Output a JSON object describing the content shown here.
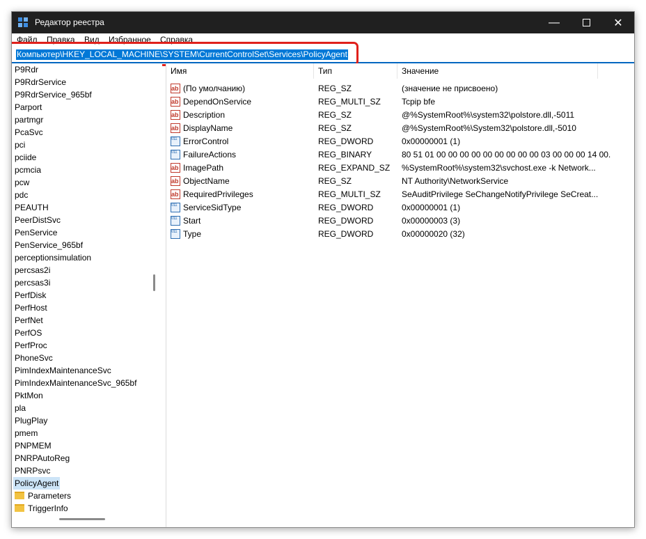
{
  "window": {
    "title": "Редактор реестра",
    "controls": {
      "minimize": "—",
      "maximize": "",
      "close": "✕"
    }
  },
  "menu": [
    "Файл",
    "Правка",
    "Вид",
    "Избранное",
    "Справка"
  ],
  "address": "Компьютер\\HKEY_LOCAL_MACHINE\\SYSTEM\\CurrentControlSet\\Services\\PolicyAgent",
  "tree": [
    "P9Rdr",
    "P9RdrService",
    "P9RdrService_965bf",
    "Parport",
    "partmgr",
    "PcaSvc",
    "pci",
    "pciide",
    "pcmcia",
    "pcw",
    "pdc",
    "PEAUTH",
    "PeerDistSvc",
    "PenService",
    "PenService_965bf",
    "perceptionsimulation",
    "percsas2i",
    "percsas3i",
    "PerfDisk",
    "PerfHost",
    "PerfNet",
    "PerfOS",
    "PerfProc",
    "PhoneSvc",
    "PimIndexMaintenanceSvc",
    "PimIndexMaintenanceSvc_965bf",
    "PktMon",
    "pla",
    "PlugPlay",
    "pmem",
    "PNPMEM",
    "PNRPAutoReg",
    "PNRPsvc",
    "PolicyAgent"
  ],
  "tree_selected": "PolicyAgent",
  "tree_children": [
    "Parameters",
    "TriggerInfo"
  ],
  "columns": {
    "name": "Имя",
    "type": "Тип",
    "value": "Значение"
  },
  "values": [
    {
      "name": "(По умолчанию)",
      "type": "REG_SZ",
      "data": "(значение не присвоено)",
      "icon": "string-value-icon"
    },
    {
      "name": "DependOnService",
      "type": "REG_MULTI_SZ",
      "data": "Tcpip bfe",
      "icon": "string-value-icon"
    },
    {
      "name": "Description",
      "type": "REG_SZ",
      "data": "@%SystemRoot%\\system32\\polstore.dll,-5011",
      "icon": "string-value-icon"
    },
    {
      "name": "DisplayName",
      "type": "REG_SZ",
      "data": "@%SystemRoot%\\System32\\polstore.dll,-5010",
      "icon": "string-value-icon"
    },
    {
      "name": "ErrorControl",
      "type": "REG_DWORD",
      "data": "0x00000001 (1)",
      "icon": "binary-value-icon"
    },
    {
      "name": "FailureActions",
      "type": "REG_BINARY",
      "data": "80 51 01 00 00 00 00 00 00 00 00 00 03 00 00 00 14 00...",
      "icon": "binary-value-icon"
    },
    {
      "name": "ImagePath",
      "type": "REG_EXPAND_SZ",
      "data": "%SystemRoot%\\system32\\svchost.exe -k Network...",
      "icon": "string-value-icon"
    },
    {
      "name": "ObjectName",
      "type": "REG_SZ",
      "data": "NT Authority\\NetworkService",
      "icon": "string-value-icon"
    },
    {
      "name": "RequiredPrivileges",
      "type": "REG_MULTI_SZ",
      "data": "SeAuditPrivilege SeChangeNotifyPrivilege SeCreat...",
      "icon": "string-value-icon"
    },
    {
      "name": "ServiceSidType",
      "type": "REG_DWORD",
      "data": "0x00000001 (1)",
      "icon": "binary-value-icon"
    },
    {
      "name": "Start",
      "type": "REG_DWORD",
      "data": "0x00000003 (3)",
      "icon": "binary-value-icon"
    },
    {
      "name": "Type",
      "type": "REG_DWORD",
      "data": "0x00000020 (32)",
      "icon": "binary-value-icon"
    }
  ],
  "colors": {
    "titlebar": "#202020",
    "selection": "#0078d7",
    "highlight_ring": "#e0201b",
    "tree_selected": "#cce4f7"
  }
}
